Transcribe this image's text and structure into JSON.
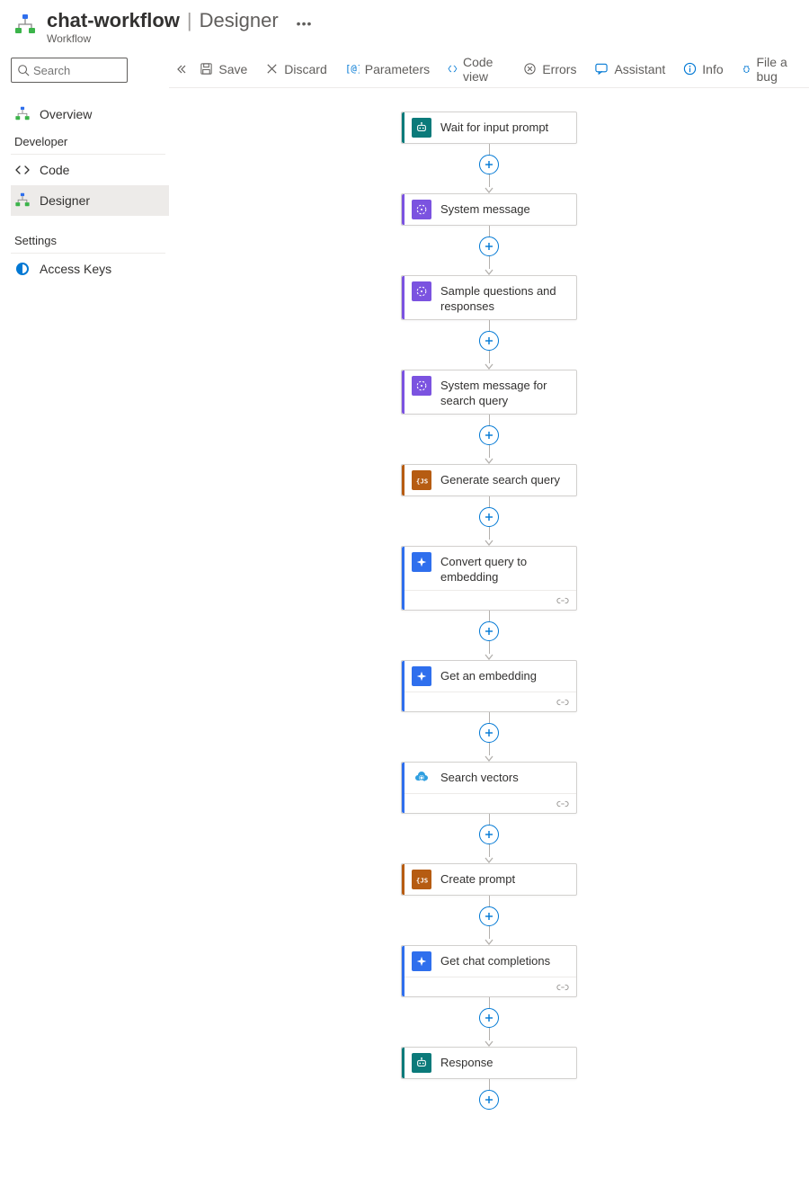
{
  "header": {
    "title": "chat-workflow",
    "section": "Designer",
    "crumb": "Workflow"
  },
  "sidebar": {
    "search_placeholder": "Search",
    "overview_label": "Overview",
    "group_dev": "Developer",
    "code_label": "Code",
    "designer_label": "Designer",
    "group_settings": "Settings",
    "access_keys_label": "Access Keys"
  },
  "toolbar": {
    "save": "Save",
    "discard": "Discard",
    "parameters": "Parameters",
    "code_view": "Code view",
    "errors": "Errors",
    "assistant": "Assistant",
    "info": "Info",
    "file_bug": "File a bug"
  },
  "nodes": [
    {
      "title": "Wait for input prompt",
      "accent": "#0b7a7a",
      "icon": "teal-agent",
      "footer_link": false
    },
    {
      "title": "System message",
      "accent": "#7b53e0",
      "icon": "purple-code",
      "footer_link": false
    },
    {
      "title": "Sample questions and responses",
      "accent": "#7b53e0",
      "icon": "purple-code",
      "footer_link": false
    },
    {
      "title": "System message for search query",
      "accent": "#7b53e0",
      "icon": "purple-code",
      "footer_link": false
    },
    {
      "title": "Generate search query",
      "accent": "#b65c12",
      "icon": "orange-js",
      "footer_link": false
    },
    {
      "title": "Convert query to embedding",
      "accent": "#2f6fed",
      "icon": "blue-spark",
      "footer_link": true
    },
    {
      "title": "Get an embedding",
      "accent": "#2f6fed",
      "icon": "blue-spark",
      "footer_link": true
    },
    {
      "title": "Search vectors",
      "accent": "#2f6fed",
      "icon": "cloud-search",
      "footer_link": true
    },
    {
      "title": "Create prompt",
      "accent": "#b65c12",
      "icon": "orange-js",
      "footer_link": false
    },
    {
      "title": "Get chat completions",
      "accent": "#2f6fed",
      "icon": "blue-spark",
      "footer_link": true
    },
    {
      "title": "Response",
      "accent": "#0b7a7a",
      "icon": "teal-agent",
      "footer_link": false
    }
  ]
}
